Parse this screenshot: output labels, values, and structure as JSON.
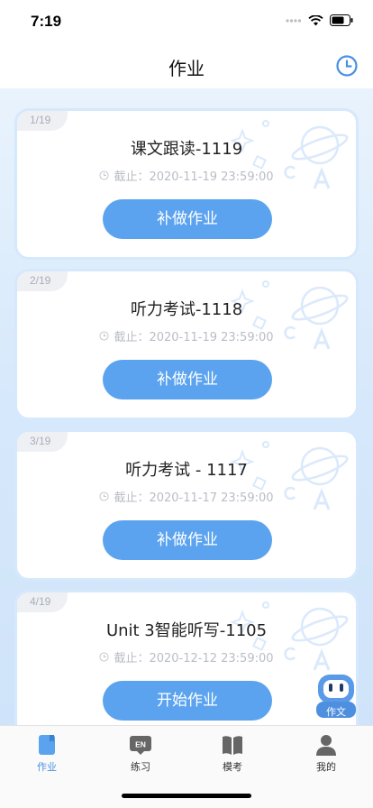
{
  "status": {
    "time": "7:19"
  },
  "header": {
    "title": "作业",
    "history_icon": "clock-icon"
  },
  "accent_color": "#5ba3ef",
  "assignments": [
    {
      "index": "1/19",
      "title": "课文跟读-1119",
      "deadline": "截止：2020-11-19 23:59:00",
      "action": "补做作业"
    },
    {
      "index": "2/19",
      "title": "听力考试-1118",
      "deadline": "截止：2020-11-19 23:59:00",
      "action": "补做作业"
    },
    {
      "index": "3/19",
      "title": "听力考试 - 1117",
      "deadline": "截止：2020-11-17 23:59:00",
      "action": "补做作业"
    },
    {
      "index": "4/19",
      "title": "Unit 3智能听写-1105",
      "deadline": "截止：2020-12-12 23:59:00",
      "action": "开始作业"
    }
  ],
  "mascot": {
    "label": "作文"
  },
  "tabs": [
    {
      "label": "作业",
      "icon": "homework-icon",
      "active": true
    },
    {
      "label": "练习",
      "icon": "en-practice-icon",
      "active": false
    },
    {
      "label": "模考",
      "icon": "book-icon",
      "active": false
    },
    {
      "label": "我的",
      "icon": "profile-icon",
      "active": false
    }
  ]
}
